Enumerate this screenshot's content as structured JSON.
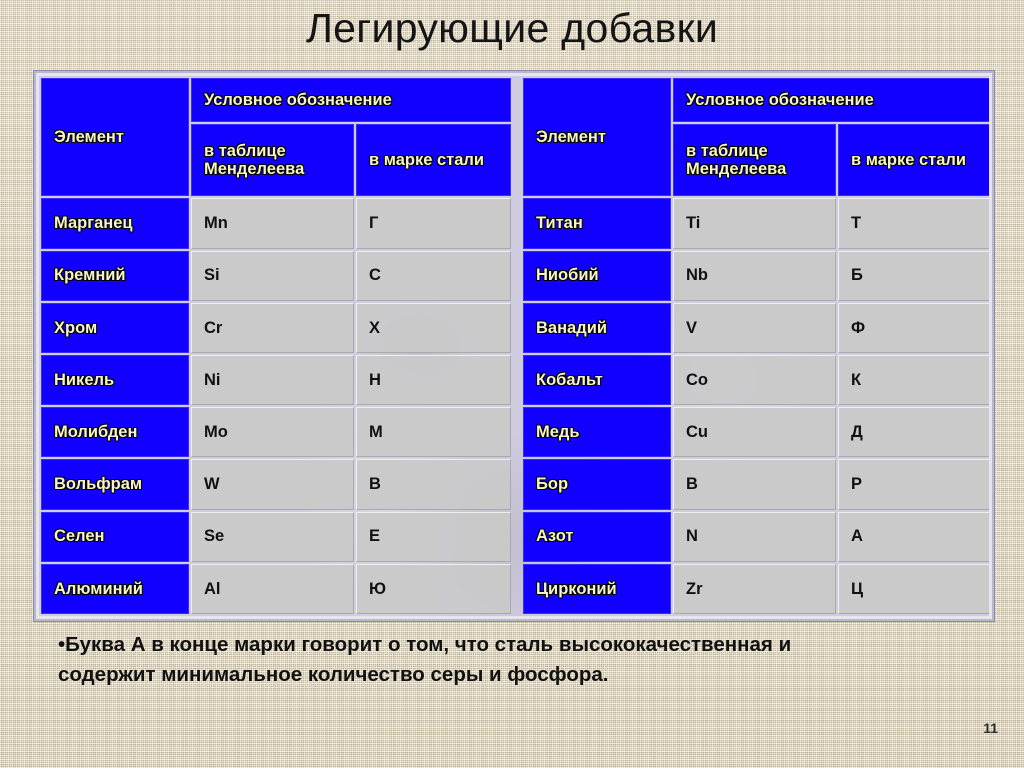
{
  "slide": {
    "title": "Легирующие добавки",
    "page_number": "11"
  },
  "colors": {
    "header_blue": "#1100FF",
    "header_text": "#F7F4C4",
    "cell_grey": "#C9C9C9",
    "cell_text": "#111111",
    "background_beige": "#D9CFB7",
    "frame_lavender": "#B9B6CF"
  },
  "table": {
    "headers": {
      "element": "Элемент",
      "designation": "Условное обозначение",
      "in_mendeleev_table": "в таблице Менделеева",
      "in_steel_grade_left": "в марке стали",
      "in_steel_grade_right": "в марке стали"
    },
    "left_rows": [
      {
        "element": "Марганец",
        "symbol": "Mn",
        "mark": "Г"
      },
      {
        "element": "Кремний",
        "symbol": "Si",
        "mark": "С"
      },
      {
        "element": "Хром",
        "symbol": "Cr",
        "mark": "Х"
      },
      {
        "element": "Никель",
        "symbol": "Ni",
        "mark": "Н"
      },
      {
        "element": "Молибден",
        "symbol": "Mo",
        "mark": "М"
      },
      {
        "element": "Вольфрам",
        "symbol": "W",
        "mark": "В"
      },
      {
        "element": "Селен",
        "symbol": "Se",
        "mark": "Е"
      },
      {
        "element": "Алюминий",
        "symbol": "Al",
        "mark": "Ю"
      }
    ],
    "right_rows": [
      {
        "element": "Титан",
        "symbol": "Ti",
        "mark": "Т"
      },
      {
        "element": "Ниобий",
        "symbol": "Nb",
        "mark": "Б"
      },
      {
        "element": "Ванадий",
        "symbol": "V",
        "mark": "Ф"
      },
      {
        "element": "Кобальт",
        "symbol": "Co",
        "mark": "К"
      },
      {
        "element": "Медь",
        "symbol": "Cu",
        "mark": "Д"
      },
      {
        "element": "Бор",
        "symbol": "B",
        "mark": "Р"
      },
      {
        "element": "Азот",
        "symbol": "N",
        "mark": "А"
      },
      {
        "element": "Цирконий",
        "symbol": "Zr",
        "mark": "Ц"
      }
    ]
  },
  "caption": {
    "line1": "•Буква А в конце марки  говорит о том, что сталь высококачественная и",
    "line2": "содержит минимальное количество серы и фосфора."
  }
}
